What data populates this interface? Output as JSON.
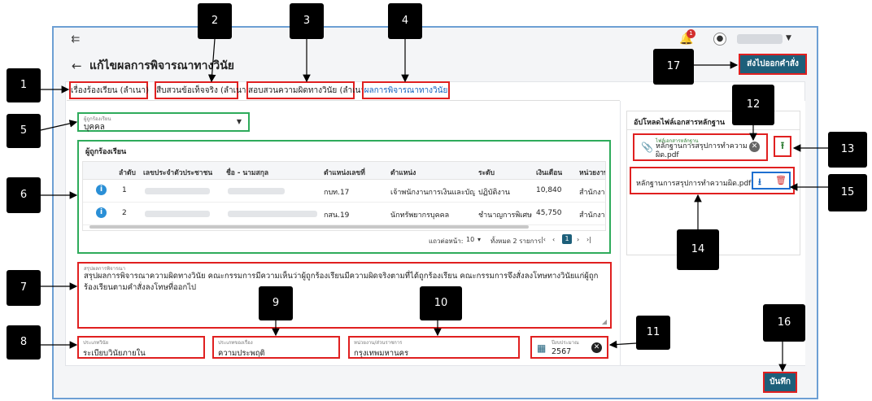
{
  "header": {
    "collapse_icon": "collapse-menu-icon",
    "notification_count": "1",
    "page_title": "แก้ไขผลการพิจารณาทางวินัย"
  },
  "tabs": [
    {
      "label": "เรื่องร้องเรียน (ลำเนา)"
    },
    {
      "label": "สืบสวนข้อเท็จจริง (ลำเนา)"
    },
    {
      "label": "สอบสวนความผิดทางวินัย (ลำเนา)"
    },
    {
      "label": "ผลการพิจารณาทางวินัย"
    }
  ],
  "complainant_type": {
    "label": "ผู้ถูกร้องเรียน",
    "value": "บุคคล"
  },
  "table": {
    "caption": "ผู้ถูกร้องเรียน",
    "columns": [
      "ลำดับ",
      "เลขประจำตัวประชาชน",
      "ชื่อ - นามสกุล",
      "ตำแหน่งเลขที่",
      "ตำแหน่ง",
      "ระดับ",
      "เงินเดือน",
      "หน่วยงาน"
    ],
    "rows": [
      {
        "no": "1",
        "position_no": "กบท.17",
        "position": "เจ้าพนักงานการเงินและบัญชี",
        "level": "ปฏิบัติงาน",
        "salary": "10,840",
        "unit": "สำนักงาน"
      },
      {
        "no": "2",
        "position_no": "กสน.19",
        "position": "นักทรัพยากรบุคคล",
        "level": "ชำนาญการพิเศษ",
        "salary": "45,750",
        "unit": "สำนักงาน"
      }
    ],
    "pager": {
      "rows_per_page_label": "แถวต่อหน้า:",
      "rows_per_page": "10",
      "total": "ทั้งหมด 2 รายการ",
      "current_page": "1"
    }
  },
  "summary": {
    "label": "สรุปผลการพิจารณา",
    "text": "สรุปผลการพิจารณาความผิดทางวินัย คณะกรรมการมีความเห็นว่าผู้ถูกร้องเรียนมีความผิดจริงตามที่ได้ถูกร้องเรียน คณะกรรมการจึงสั่งลงโทษทางวินัยแก่ผู้ถูกร้องเรียนตามคำสั่งลงโทษที่ออกไป"
  },
  "fields": {
    "discipline_type": {
      "label": "ประเภทวินัย",
      "value": "ระเบียบวินัยภายใน"
    },
    "complaint_type": {
      "label": "ประเภทของเรื่อง",
      "value": "ความประพฤติ"
    },
    "agency": {
      "label": "หน่วยงาน/ส่วนราชการ",
      "value": "กรุงเทพมหานคร"
    },
    "budget_year": {
      "label": "ปีงบประมาณ",
      "value": "2567"
    }
  },
  "upload": {
    "header": "อัปโหลดไฟล์เอกสารหลักฐาน",
    "input_label": "ไฟล์เอกสารหลักฐาน",
    "input_value": "หลักฐานการสรุปการทำความผิด.pdf",
    "file_name": "หลักฐานการสรุปการทำความผิด.pdf"
  },
  "buttons": {
    "send_order": "ส่งไปออกคำสั่ง",
    "save": "บันทึก"
  },
  "callouts": [
    "1",
    "2",
    "3",
    "4",
    "5",
    "6",
    "7",
    "8",
    "9",
    "10",
    "11",
    "12",
    "13",
    "14",
    "15",
    "16",
    "17"
  ],
  "colors": {
    "primary": "#1d5f7a",
    "highlight_red": "#e02020",
    "highlight_green": "#2eab5b",
    "highlight_blue": "#1e6fd0"
  }
}
